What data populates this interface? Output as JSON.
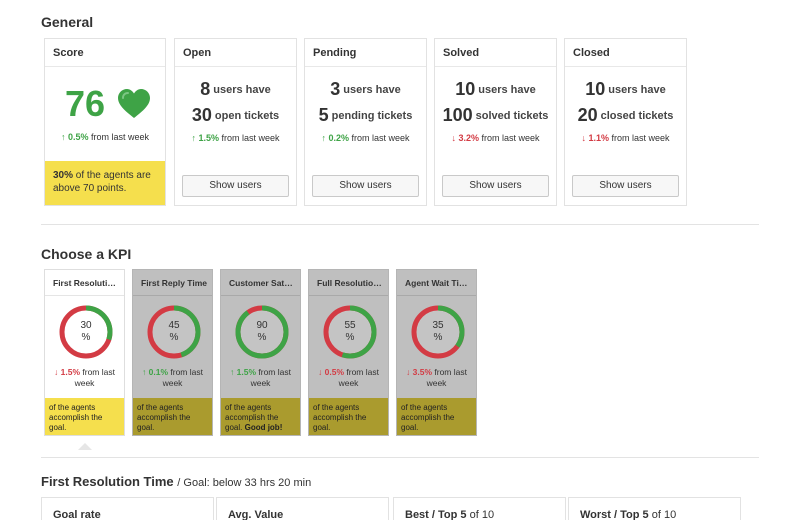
{
  "general": {
    "title": "General",
    "score": {
      "title": "Score",
      "value": "76",
      "delta_pct": "0.5%",
      "delta_text": "from last week",
      "delta_dir": "up",
      "note_bold": "30%",
      "note_text": "of the agents are above 70 points."
    },
    "cards": [
      {
        "title": "Open",
        "users": "8",
        "users_label": "users have",
        "tickets": "30",
        "tickets_label": "open tickets",
        "delta_pct": "1.5%",
        "delta_dir": "up",
        "delta_text": "from last week",
        "button": "Show users"
      },
      {
        "title": "Pending",
        "users": "3",
        "users_label": "users have",
        "tickets": "5",
        "tickets_label": "pending tickets",
        "delta_pct": "0.2%",
        "delta_dir": "up",
        "delta_text": "from last week",
        "button": "Show users"
      },
      {
        "title": "Solved",
        "users": "10",
        "users_label": "users have",
        "tickets": "100",
        "tickets_label": "solved tickets",
        "delta_pct": "3.2%",
        "delta_dir": "down",
        "delta_text": "from last week",
        "button": "Show users"
      },
      {
        "title": "Closed",
        "users": "10",
        "users_label": "users have",
        "tickets": "20",
        "tickets_label": "closed tickets",
        "delta_pct": "1.1%",
        "delta_dir": "down",
        "delta_text": "from last week",
        "button": "Show users"
      }
    ]
  },
  "kpi": {
    "title": "Choose a KPI",
    "items": [
      {
        "title": "First Resolution Time",
        "value": "30",
        "unit": "%",
        "percent": 30,
        "delta_pct": "1.5%",
        "delta_dir": "down",
        "delta_text": "from last week",
        "note": "of the agents accomplish the goal.",
        "note_bold": "",
        "active": true
      },
      {
        "title": "First Reply Time",
        "value": "45",
        "unit": "%",
        "percent": 45,
        "delta_pct": "0.1%",
        "delta_dir": "up",
        "delta_text": "from last week",
        "note": "of the agents accomplish the goal.",
        "note_bold": "",
        "active": false
      },
      {
        "title": "Customer Satisfaction",
        "value": "90",
        "unit": "%",
        "percent": 90,
        "delta_pct": "1.5%",
        "delta_dir": "up",
        "delta_text": "from last week",
        "note": "of the agents accomplish the goal.",
        "note_bold": "Good job!",
        "active": false
      },
      {
        "title": "Full Resolution Time",
        "value": "55",
        "unit": "%",
        "percent": 55,
        "delta_pct": "0.5%",
        "delta_dir": "down",
        "delta_text": "from last week",
        "note": "of the agents accomplish the goal.",
        "note_bold": "",
        "active": false
      },
      {
        "title": "Agent Wait Time",
        "value": "35",
        "unit": "%",
        "percent": 35,
        "delta_pct": "3.5%",
        "delta_dir": "down",
        "delta_text": "from last week",
        "note": "of the agents accomplish the goal.",
        "note_bold": "",
        "active": false
      }
    ]
  },
  "detail": {
    "title": "First Resolution Time",
    "goal": "/ Goal: below 33 hrs 20 min",
    "cards": [
      {
        "title": "Goal rate",
        "suffix": ""
      },
      {
        "title": "Avg. Value",
        "suffix": ""
      },
      {
        "title": "Best / Top 5",
        "suffix": "of 10"
      },
      {
        "title": "Worst / Top 5",
        "suffix": "of 10"
      }
    ]
  },
  "colors": {
    "green": "#3ea346",
    "red": "#d33b44",
    "yellow": "#f5df4d",
    "olive": "#aa9b2e",
    "gray_card": "#bfbfbf"
  },
  "icons": {
    "score_icon": "heart-icon",
    "up": "arrow-up-icon",
    "down": "arrow-down-icon"
  }
}
